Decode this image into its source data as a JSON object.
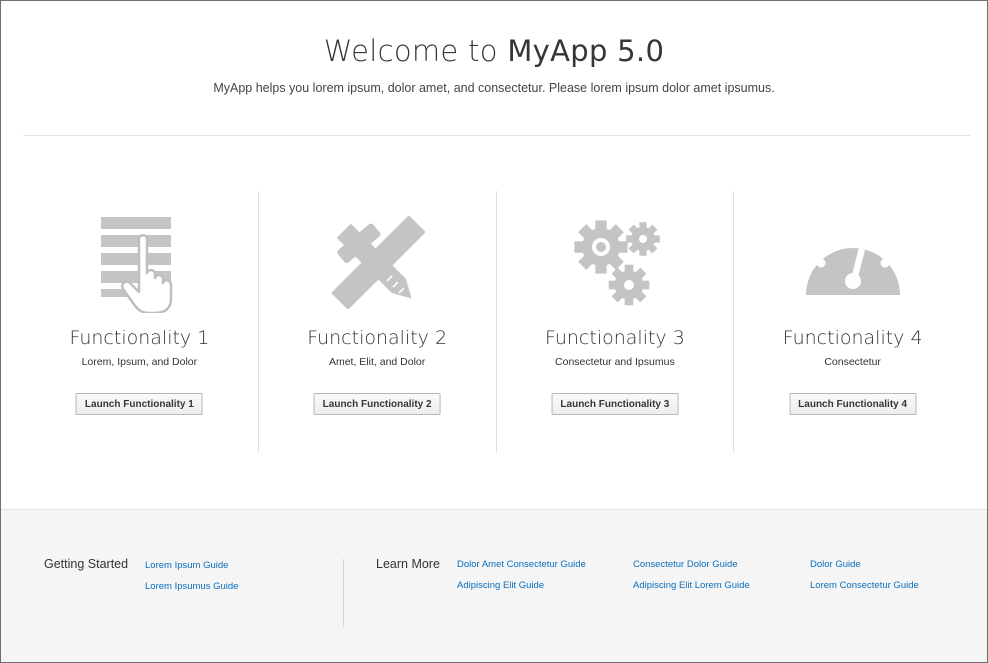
{
  "header": {
    "title_prefix": "Welcome to ",
    "title_brand": "MyApp 5.0",
    "subtitle": "MyApp helps you lorem ipsum, dolor amet, and consectetur. Please lorem ipsum dolor amet ipsumus."
  },
  "features": [
    {
      "title": "Functionality 1",
      "description": "Lorem, Ipsum, and Dolor",
      "button_label": "Launch Functionality 1",
      "icon": "list-touch-icon"
    },
    {
      "title": "Functionality 2",
      "description": "Amet, Elit, and Dolor",
      "button_label": "Launch Functionality 2",
      "icon": "tools-icon"
    },
    {
      "title": "Functionality 3",
      "description": "Consectetur and Ipsumus",
      "button_label": "Launch Functionality 3",
      "icon": "gears-icon"
    },
    {
      "title": "Functionality 4",
      "description": "Consectetur",
      "button_label": "Launch Functionality 4",
      "icon": "gauge-icon"
    }
  ],
  "footer": {
    "getting_started": {
      "heading": "Getting Started",
      "links": [
        "Lorem Ipsum Guide",
        "Lorem Ipsumus Guide"
      ]
    },
    "learn_more": {
      "heading": "Learn More",
      "links": [
        "Dolor Amet Consectetur Guide",
        "Adipiscing Elit Guide",
        "Consectetur Dolor Guide",
        "Adipiscing Elit Lorem Guide",
        "Dolor Guide",
        "Lorem Consectetur Guide"
      ]
    }
  },
  "colors": {
    "icon_gray": "#c4c4c4",
    "link_blue": "#0a6ebd",
    "footer_bg": "#f5f5f5"
  }
}
